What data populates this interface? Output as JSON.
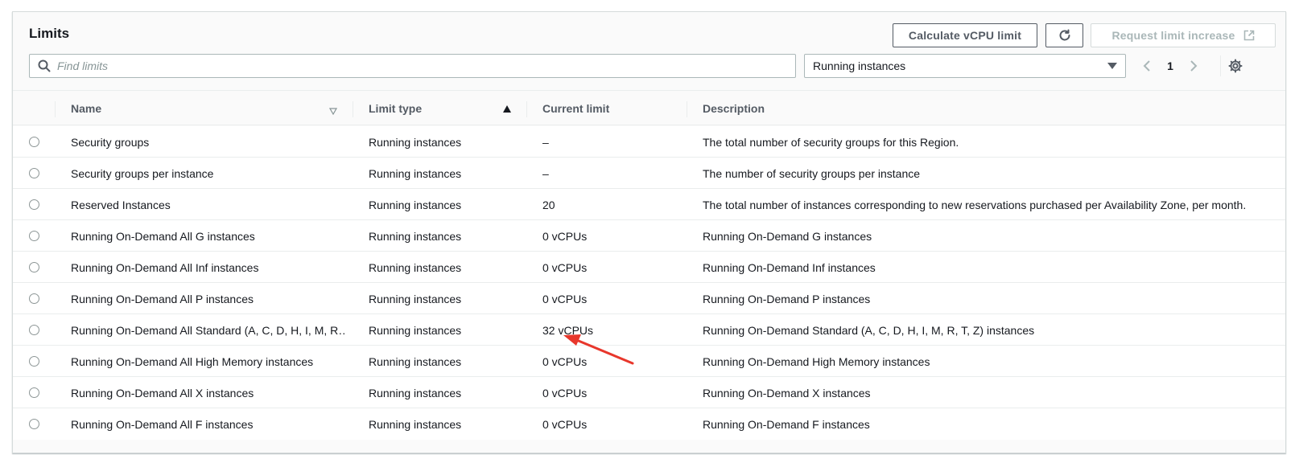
{
  "header": {
    "title": "Limits",
    "calc_label": "Calculate vCPU limit",
    "request_label": "Request limit increase"
  },
  "search": {
    "placeholder": "Find limits"
  },
  "filter": {
    "selected": "Running instances"
  },
  "pagination": {
    "current_page": "1"
  },
  "columns": {
    "name": "Name",
    "limit_type": "Limit type",
    "current_limit": "Current limit",
    "description": "Description"
  },
  "rows": [
    {
      "name": "Security groups",
      "type": "Running instances",
      "limit": "–",
      "description": "The total number of security groups for this Region."
    },
    {
      "name": "Security groups per instance",
      "type": "Running instances",
      "limit": "–",
      "description": "The number of security groups per instance"
    },
    {
      "name": "Reserved Instances",
      "type": "Running instances",
      "limit": "20",
      "description": "The total number of instances corresponding to new reservations purchased per Availability Zone, per month."
    },
    {
      "name": "Running On-Demand All G instances",
      "type": "Running instances",
      "limit": "0 vCPUs",
      "description": "Running On-Demand G instances"
    },
    {
      "name": "Running On-Demand All Inf instances",
      "type": "Running instances",
      "limit": "0 vCPUs",
      "description": "Running On-Demand Inf instances"
    },
    {
      "name": "Running On-Demand All P instances",
      "type": "Running instances",
      "limit": "0 vCPUs",
      "description": "Running On-Demand P instances"
    },
    {
      "name": "Running On-Demand All Standard (A, C, D, H, I, M, R…",
      "type": "Running instances",
      "limit": "32 vCPUs",
      "description": "Running On-Demand Standard (A, C, D, H, I, M, R, T, Z) instances"
    },
    {
      "name": "Running On-Demand All High Memory instances",
      "type": "Running instances",
      "limit": "0 vCPUs",
      "description": "Running On-Demand High Memory instances"
    },
    {
      "name": "Running On-Demand All X instances",
      "type": "Running instances",
      "limit": "0 vCPUs",
      "description": "Running On-Demand X instances"
    },
    {
      "name": "Running On-Demand All F instances",
      "type": "Running instances",
      "limit": "0 vCPUs",
      "description": "Running On-Demand F instances"
    }
  ],
  "colors": {
    "annotation_arrow": "#e8372c",
    "border": "#d5dbdb",
    "text_primary": "#16191f",
    "text_secondary": "#545b64"
  }
}
